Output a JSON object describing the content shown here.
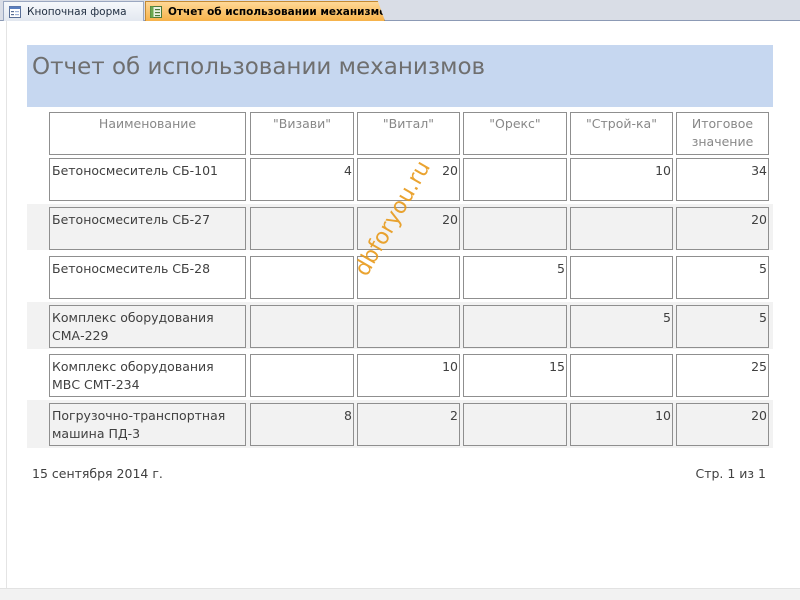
{
  "tabs": [
    {
      "label": "Кнопочная форма",
      "icon": "form-icon",
      "active": false
    },
    {
      "label": "Отчет об использовании механизмов",
      "icon": "report-icon",
      "active": true
    }
  ],
  "report": {
    "title": "Отчет об использовании механизмов",
    "columns": [
      "Наименование",
      "\"Визави\"",
      "\"Витал\"",
      "\"Орекс\"",
      "\"Строй-ка\"",
      "Итоговое значение"
    ],
    "rows": [
      {
        "name": "Бетоносмеситель СБ-101",
        "vizavi": "4",
        "vital": "20",
        "oreks": "",
        "stroika": "10",
        "total": "34"
      },
      {
        "name": "Бетоносмеситель СБ-27",
        "vizavi": "",
        "vital": "20",
        "oreks": "",
        "stroika": "",
        "total": "20"
      },
      {
        "name": "Бетоносмеситель СБ-28",
        "vizavi": "",
        "vital": "",
        "oreks": "5",
        "stroika": "",
        "total": "5"
      },
      {
        "name": "Комплекс оборудования СМА-229",
        "vizavi": "",
        "vital": "",
        "oreks": "",
        "stroika": "5",
        "total": "5"
      },
      {
        "name": "Комплекс оборудования МВС СМТ-234",
        "vizavi": "",
        "vital": "10",
        "oreks": "15",
        "stroika": "",
        "total": "25"
      },
      {
        "name": "Погрузочно-транспортная машина ПД-3",
        "vizavi": "8",
        "vital": "2",
        "oreks": "",
        "stroika": "10",
        "total": "20"
      }
    ],
    "footer": {
      "date": "15 сентября 2014 г.",
      "page": "Стр. 1 из 1"
    },
    "watermark": "dbforyou.ru"
  }
}
